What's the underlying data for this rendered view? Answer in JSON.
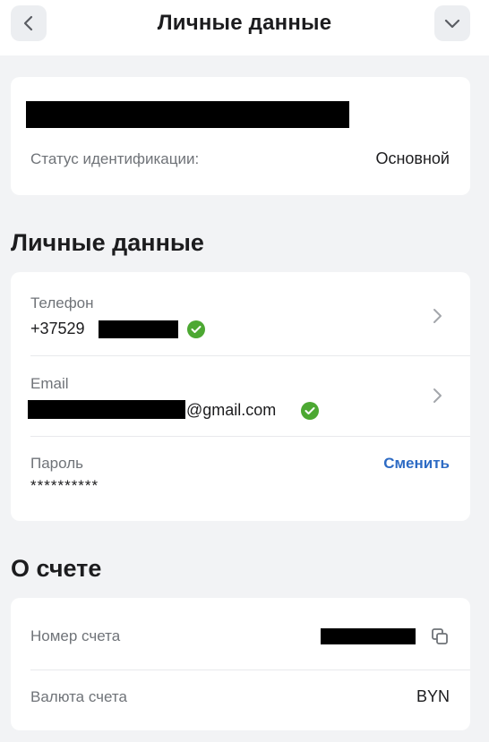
{
  "header": {
    "title": "Личные данные",
    "back_icon": "chevron-left-icon",
    "menu_icon": "chevron-down-icon"
  },
  "identification": {
    "status_label": "Статус идентификации:",
    "status_value": "Основной"
  },
  "personal": {
    "section_title": "Личные данные",
    "phone_label": "Телефон",
    "phone_prefix": "+37529",
    "email_label": "Email",
    "email_suffix": "@gmail.com",
    "password_label": "Пароль",
    "password_value": "**********",
    "change_label": "Сменить"
  },
  "account": {
    "section_title": "О счете",
    "number_label": "Номер счета",
    "currency_label": "Валюта счета",
    "currency_value": "BYN"
  },
  "colors": {
    "accent": "#2d6bc4",
    "verified": "#4ca832",
    "background": "#f2f3f5"
  }
}
